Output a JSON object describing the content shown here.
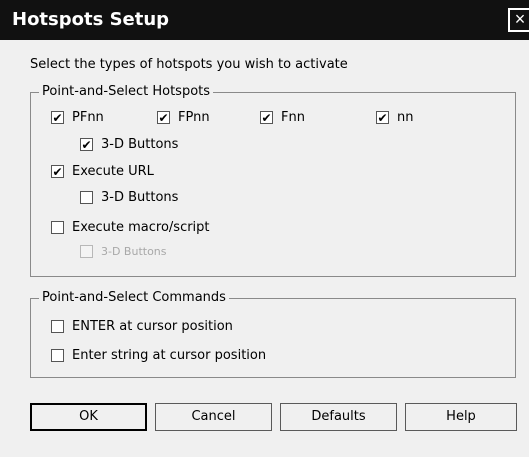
{
  "window": {
    "title": "Hotspots Setup",
    "close_glyph": "×"
  },
  "instruction": "Select the types of hotspots you wish to activate",
  "hotspots_group": {
    "title": "Point-and-Select Hotspots",
    "pfnn": {
      "label": "PFnn",
      "checked": true
    },
    "fpnn": {
      "label": "FPnn",
      "checked": true
    },
    "fnn": {
      "label": "Fnn",
      "checked": true
    },
    "nn": {
      "label": "nn",
      "checked": true
    },
    "pf_3d": {
      "label": "3-D Buttons",
      "checked": true
    },
    "execute_url": {
      "label": "Execute URL",
      "checked": true
    },
    "url_3d": {
      "label": "3-D Buttons",
      "checked": false
    },
    "execute_macro": {
      "label": "Execute macro/script",
      "checked": false
    },
    "macro_3d": {
      "label": "3-D Buttons",
      "checked": false,
      "disabled": true
    }
  },
  "commands_group": {
    "title": "Point-and-Select Commands",
    "enter_at_cursor": {
      "label": "ENTER at cursor position",
      "checked": false
    },
    "enter_string": {
      "label": "Enter string at cursor position",
      "checked": false
    }
  },
  "buttons": {
    "ok": "OK",
    "cancel": "Cancel",
    "defaults": "Defaults",
    "help": "Help"
  },
  "check_glyph": "✔"
}
